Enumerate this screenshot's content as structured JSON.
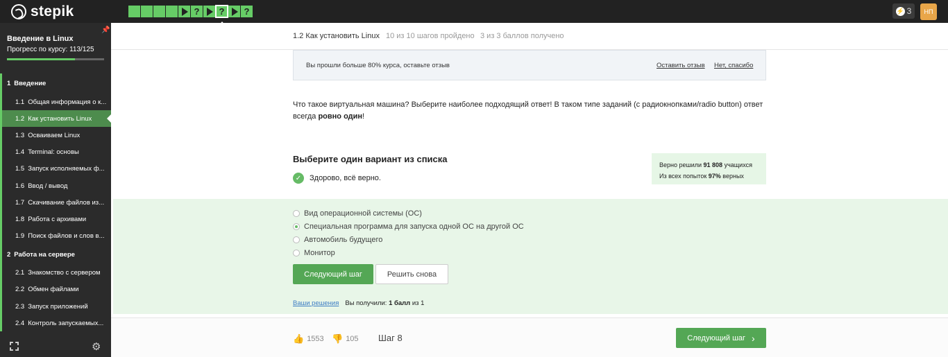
{
  "brand": {
    "name": "stepik"
  },
  "topbar": {
    "steps": [
      "done",
      "done",
      "done",
      "done",
      "play",
      "quiz",
      "play",
      "quiz-current",
      "play",
      "quiz"
    ],
    "energy": "3",
    "avatar_initials": "НП"
  },
  "sidebar": {
    "course_title": "Введение в Linux",
    "progress_label": "Прогресс по курсу:  113/125",
    "progress": 0.904,
    "items": [
      {
        "type": "section",
        "num": "1",
        "label": "Введение"
      },
      {
        "type": "lesson",
        "num": "1.1",
        "label": "Общая информация о к..."
      },
      {
        "type": "lesson",
        "num": "1.2",
        "label": "Как установить Linux",
        "active": true
      },
      {
        "type": "lesson",
        "num": "1.3",
        "label": "Осваиваем Linux"
      },
      {
        "type": "lesson",
        "num": "1.4",
        "label": "Terminal: основы"
      },
      {
        "type": "lesson",
        "num": "1.5",
        "label": "Запуск исполняемых ф..."
      },
      {
        "type": "lesson",
        "num": "1.6",
        "label": "Ввод / вывод"
      },
      {
        "type": "lesson",
        "num": "1.7",
        "label": "Скачивание файлов из..."
      },
      {
        "type": "lesson",
        "num": "1.8",
        "label": "Работа с архивами"
      },
      {
        "type": "lesson",
        "num": "1.9",
        "label": "Поиск файлов и слов в..."
      },
      {
        "type": "section",
        "num": "2",
        "label": "Работа на сервере"
      },
      {
        "type": "lesson",
        "num": "2.1",
        "label": "Знакомство с сервером"
      },
      {
        "type": "lesson",
        "num": "2.2",
        "label": "Обмен файлами"
      },
      {
        "type": "lesson",
        "num": "2.3",
        "label": "Запуск приложений"
      },
      {
        "type": "lesson",
        "num": "2.4",
        "label": "Контроль запускаемых..."
      }
    ]
  },
  "lesson": {
    "title": "1.2 Как установить Linux",
    "steps_done": "10 из 10 шагов пройдено",
    "points": "3 из 3 баллов  получено"
  },
  "feedback": {
    "text": "Вы прошли больше 80% курса, оставьте отзыв",
    "leave_review": "Оставить отзыв",
    "no_thanks": "Нет, спасибо"
  },
  "question": {
    "text_before": "Что такое виртуальная машина? Выберите наиболее подходящий ответ! В таком типе заданий (с радиокнопками/radio button) ответ всегда ",
    "text_bold": "ровно один",
    "text_after": "!",
    "choose_title": "Выберите один вариант из списка",
    "correct_message": "Здорово, всё верно."
  },
  "stats": {
    "line1_prefix": "Верно решили ",
    "line1_value": "91 808",
    "line1_suffix": " учащихся",
    "line2_prefix": "Из всех попыток ",
    "line2_value": "97%",
    "line2_suffix": " верных"
  },
  "options": [
    {
      "label": "Вид операционной системы (ОС)",
      "checked": false
    },
    {
      "label": "Специальная программа для запуска одной ОС на другой ОС",
      "checked": true
    },
    {
      "label": "Автомобиль будущего",
      "checked": false
    },
    {
      "label": "Монитор",
      "checked": false
    }
  ],
  "buttons": {
    "next_step": "Следующий шаг",
    "retry": "Решить снова"
  },
  "score": {
    "your_solutions": "Ваши решения",
    "received_prefix": "Вы получили: ",
    "received_value": "1 балл",
    "received_suffix": " из 1"
  },
  "footer": {
    "likes": "1553",
    "dislikes": "105",
    "step_label": "Шаг 8",
    "next_step": "Следующий шаг"
  },
  "colors": {
    "accent": "#54a755",
    "progress": "#66cc66",
    "topbar": "#222222",
    "sidebar": "#2b2b2b",
    "avatar": "#e9a649"
  }
}
